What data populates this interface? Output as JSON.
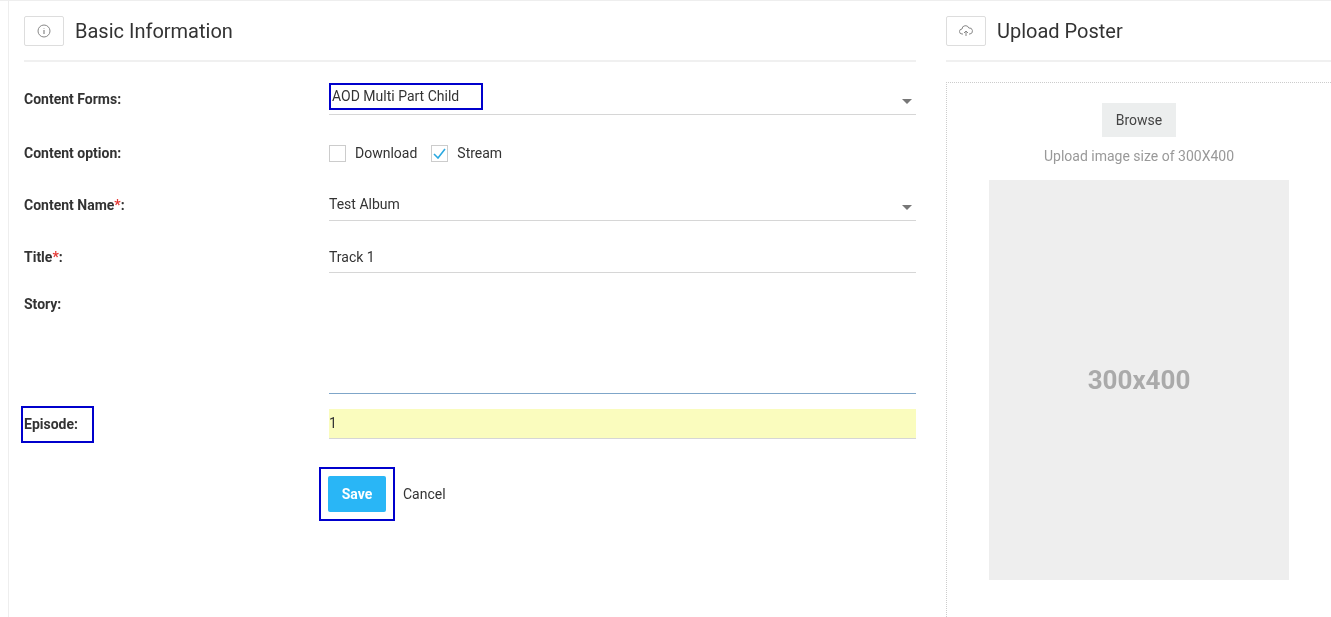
{
  "basic_info": {
    "title": "Basic Information"
  },
  "fields": [
    {
      "kind": "select",
      "label": "Content Forms:",
      "value": "AOD Multi Part Child",
      "highlighted": true
    },
    {
      "kind": "checkboxes",
      "label": "Content option:",
      "options": [
        {
          "label": "Download",
          "checked": false
        },
        {
          "label": "Stream",
          "checked": true
        }
      ]
    },
    {
      "kind": "select",
      "label": "Content Name",
      "required_mark": "*",
      "label_end": ":",
      "value": "Test Album"
    },
    {
      "kind": "text",
      "label": "Title",
      "required_mark": "*",
      "label_end": ":",
      "value": "Track 1"
    },
    {
      "kind": "textarea",
      "label": "Story:",
      "focused": true
    },
    {
      "kind": "text",
      "label": "Episode:",
      "value": "1",
      "label_highlighted": true,
      "autofilled": true
    }
  ],
  "actions": {
    "save": {
      "label": "Save",
      "highlighted": true
    },
    "cancel": {
      "label": "Cancel"
    }
  },
  "poster": {
    "title": "Upload Poster",
    "browse": "Browse",
    "hint": "Upload image size of 300X400",
    "placeholder_text": "300x400"
  }
}
